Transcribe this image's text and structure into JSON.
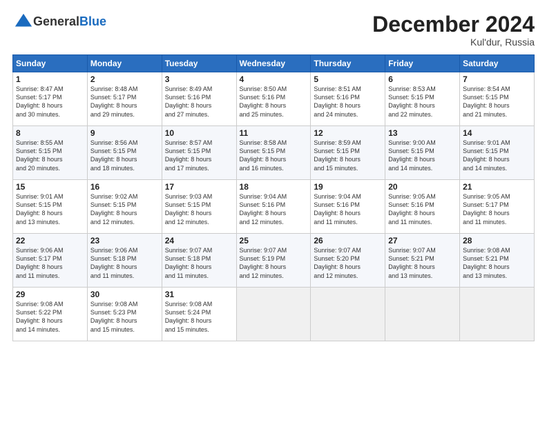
{
  "header": {
    "logo_line1": "General",
    "logo_line2": "Blue",
    "month": "December 2024",
    "location": "Kul'dur, Russia"
  },
  "weekdays": [
    "Sunday",
    "Monday",
    "Tuesday",
    "Wednesday",
    "Thursday",
    "Friday",
    "Saturday"
  ],
  "weeks": [
    [
      {
        "day": "1",
        "lines": [
          "Sunrise: 8:47 AM",
          "Sunset: 5:17 PM",
          "Daylight: 8 hours",
          "and 30 minutes."
        ]
      },
      {
        "day": "2",
        "lines": [
          "Sunrise: 8:48 AM",
          "Sunset: 5:17 PM",
          "Daylight: 8 hours",
          "and 29 minutes."
        ]
      },
      {
        "day": "3",
        "lines": [
          "Sunrise: 8:49 AM",
          "Sunset: 5:16 PM",
          "Daylight: 8 hours",
          "and 27 minutes."
        ]
      },
      {
        "day": "4",
        "lines": [
          "Sunrise: 8:50 AM",
          "Sunset: 5:16 PM",
          "Daylight: 8 hours",
          "and 25 minutes."
        ]
      },
      {
        "day": "5",
        "lines": [
          "Sunrise: 8:51 AM",
          "Sunset: 5:16 PM",
          "Daylight: 8 hours",
          "and 24 minutes."
        ]
      },
      {
        "day": "6",
        "lines": [
          "Sunrise: 8:53 AM",
          "Sunset: 5:15 PM",
          "Daylight: 8 hours",
          "and 22 minutes."
        ]
      },
      {
        "day": "7",
        "lines": [
          "Sunrise: 8:54 AM",
          "Sunset: 5:15 PM",
          "Daylight: 8 hours",
          "and 21 minutes."
        ]
      }
    ],
    [
      {
        "day": "8",
        "lines": [
          "Sunrise: 8:55 AM",
          "Sunset: 5:15 PM",
          "Daylight: 8 hours",
          "and 20 minutes."
        ]
      },
      {
        "day": "9",
        "lines": [
          "Sunrise: 8:56 AM",
          "Sunset: 5:15 PM",
          "Daylight: 8 hours",
          "and 18 minutes."
        ]
      },
      {
        "day": "10",
        "lines": [
          "Sunrise: 8:57 AM",
          "Sunset: 5:15 PM",
          "Daylight: 8 hours",
          "and 17 minutes."
        ]
      },
      {
        "day": "11",
        "lines": [
          "Sunrise: 8:58 AM",
          "Sunset: 5:15 PM",
          "Daylight: 8 hours",
          "and 16 minutes."
        ]
      },
      {
        "day": "12",
        "lines": [
          "Sunrise: 8:59 AM",
          "Sunset: 5:15 PM",
          "Daylight: 8 hours",
          "and 15 minutes."
        ]
      },
      {
        "day": "13",
        "lines": [
          "Sunrise: 9:00 AM",
          "Sunset: 5:15 PM",
          "Daylight: 8 hours",
          "and 14 minutes."
        ]
      },
      {
        "day": "14",
        "lines": [
          "Sunrise: 9:01 AM",
          "Sunset: 5:15 PM",
          "Daylight: 8 hours",
          "and 14 minutes."
        ]
      }
    ],
    [
      {
        "day": "15",
        "lines": [
          "Sunrise: 9:01 AM",
          "Sunset: 5:15 PM",
          "Daylight: 8 hours",
          "and 13 minutes."
        ]
      },
      {
        "day": "16",
        "lines": [
          "Sunrise: 9:02 AM",
          "Sunset: 5:15 PM",
          "Daylight: 8 hours",
          "and 12 minutes."
        ]
      },
      {
        "day": "17",
        "lines": [
          "Sunrise: 9:03 AM",
          "Sunset: 5:15 PM",
          "Daylight: 8 hours",
          "and 12 minutes."
        ]
      },
      {
        "day": "18",
        "lines": [
          "Sunrise: 9:04 AM",
          "Sunset: 5:16 PM",
          "Daylight: 8 hours",
          "and 12 minutes."
        ]
      },
      {
        "day": "19",
        "lines": [
          "Sunrise: 9:04 AM",
          "Sunset: 5:16 PM",
          "Daylight: 8 hours",
          "and 11 minutes."
        ]
      },
      {
        "day": "20",
        "lines": [
          "Sunrise: 9:05 AM",
          "Sunset: 5:16 PM",
          "Daylight: 8 hours",
          "and 11 minutes."
        ]
      },
      {
        "day": "21",
        "lines": [
          "Sunrise: 9:05 AM",
          "Sunset: 5:17 PM",
          "Daylight: 8 hours",
          "and 11 minutes."
        ]
      }
    ],
    [
      {
        "day": "22",
        "lines": [
          "Sunrise: 9:06 AM",
          "Sunset: 5:17 PM",
          "Daylight: 8 hours",
          "and 11 minutes."
        ]
      },
      {
        "day": "23",
        "lines": [
          "Sunrise: 9:06 AM",
          "Sunset: 5:18 PM",
          "Daylight: 8 hours",
          "and 11 minutes."
        ]
      },
      {
        "day": "24",
        "lines": [
          "Sunrise: 9:07 AM",
          "Sunset: 5:18 PM",
          "Daylight: 8 hours",
          "and 11 minutes."
        ]
      },
      {
        "day": "25",
        "lines": [
          "Sunrise: 9:07 AM",
          "Sunset: 5:19 PM",
          "Daylight: 8 hours",
          "and 12 minutes."
        ]
      },
      {
        "day": "26",
        "lines": [
          "Sunrise: 9:07 AM",
          "Sunset: 5:20 PM",
          "Daylight: 8 hours",
          "and 12 minutes."
        ]
      },
      {
        "day": "27",
        "lines": [
          "Sunrise: 9:07 AM",
          "Sunset: 5:21 PM",
          "Daylight: 8 hours",
          "and 13 minutes."
        ]
      },
      {
        "day": "28",
        "lines": [
          "Sunrise: 9:08 AM",
          "Sunset: 5:21 PM",
          "Daylight: 8 hours",
          "and 13 minutes."
        ]
      }
    ],
    [
      {
        "day": "29",
        "lines": [
          "Sunrise: 9:08 AM",
          "Sunset: 5:22 PM",
          "Daylight: 8 hours",
          "and 14 minutes."
        ]
      },
      {
        "day": "30",
        "lines": [
          "Sunrise: 9:08 AM",
          "Sunset: 5:23 PM",
          "Daylight: 8 hours",
          "and 15 minutes."
        ]
      },
      {
        "day": "31",
        "lines": [
          "Sunrise: 9:08 AM",
          "Sunset: 5:24 PM",
          "Daylight: 8 hours",
          "and 15 minutes."
        ]
      },
      null,
      null,
      null,
      null
    ]
  ]
}
